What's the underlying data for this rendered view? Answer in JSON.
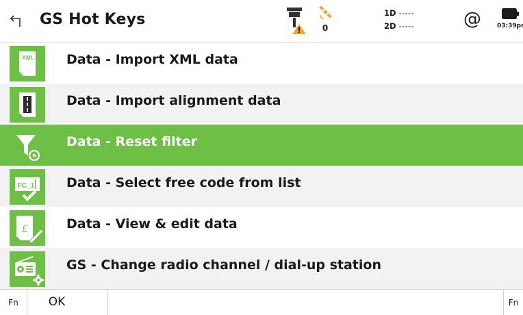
{
  "header": {
    "title": "GS Hot Keys",
    "satellite_count": "0",
    "quality": [
      {
        "label": "1D",
        "value": "-----"
      },
      {
        "label": "2D",
        "value": "-----"
      }
    ],
    "at_symbol": "@",
    "time": "03:39pm",
    "icons": {
      "back": "back-arrow-icon",
      "gnss": "gnss-receiver-warning-icon",
      "satellite": "satellite-icon",
      "battery": "battery-icon"
    }
  },
  "items": [
    {
      "label": "Data - Import XML data",
      "icon": "xml-file-icon",
      "selected": false
    },
    {
      "label": "Data - Import alignment data",
      "icon": "road-alignment-icon",
      "selected": false
    },
    {
      "label": "Data - Reset filter",
      "icon": "filter-reset-icon",
      "selected": true
    },
    {
      "label": "Data - Select free code from list",
      "icon": "free-code-icon",
      "selected": false
    },
    {
      "label": "Data - View & edit data",
      "icon": "edit-data-icon",
      "selected": false
    },
    {
      "label": "GS - Change radio channel / dial-up station",
      "icon": "radio-settings-icon",
      "selected": false
    }
  ],
  "footer": {
    "fn_left": "Fn",
    "ok": "OK",
    "fn_right": "Fn"
  },
  "colors": {
    "accent": "#6ebf45",
    "warning": "#f5a623",
    "alt_row": "#f2f2f2"
  }
}
